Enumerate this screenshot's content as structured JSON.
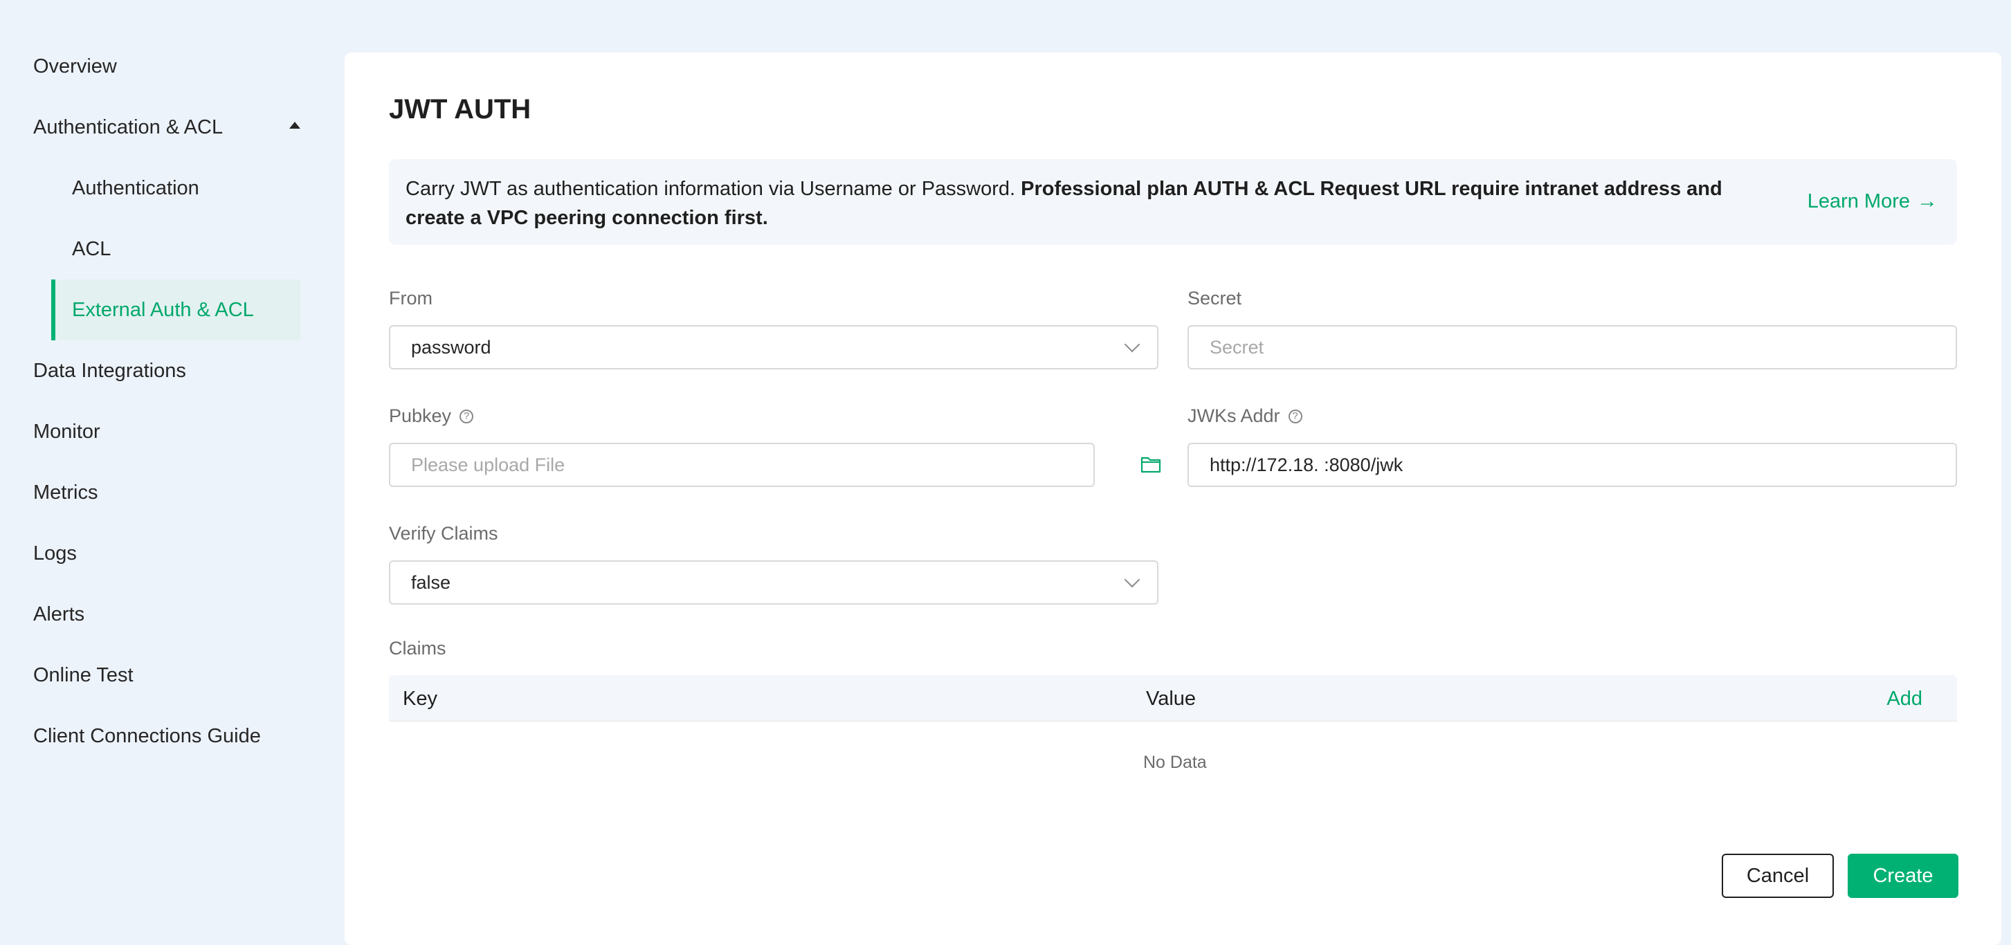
{
  "sidebar": {
    "items": [
      {
        "label": "Overview"
      },
      {
        "label": "Authentication & ACL"
      },
      {
        "label": "Authentication"
      },
      {
        "label": "ACL"
      },
      {
        "label": "External Auth & ACL"
      },
      {
        "label": "Data Integrations"
      },
      {
        "label": "Monitor"
      },
      {
        "label": "Metrics"
      },
      {
        "label": "Logs"
      },
      {
        "label": "Alerts"
      },
      {
        "label": "Online Test"
      },
      {
        "label": "Client Connections Guide"
      }
    ],
    "active": "External Auth & ACL"
  },
  "page": {
    "title": "JWT AUTH"
  },
  "banner": {
    "text_plain": "Carry JWT as authentication information via Username or Password. ",
    "text_bold": "Professional plan AUTH & ACL Request URL require intranet address and create a VPC peering connection first.",
    "learn_more": "Learn More",
    "arrow": "→"
  },
  "form": {
    "from": {
      "label": "From",
      "value": "password"
    },
    "secret": {
      "label": "Secret",
      "placeholder": "Secret"
    },
    "pubkey": {
      "label": "Pubkey",
      "placeholder": "Please upload File"
    },
    "jwks_addr": {
      "label": "JWKs Addr",
      "value": "http://172.18.   :8080/jwk"
    },
    "verify_claims": {
      "label": "Verify Claims",
      "value": "false"
    },
    "help_glyph": "?"
  },
  "claims": {
    "label": "Claims",
    "columns": [
      "Key",
      "Value"
    ],
    "add_label": "Add",
    "empty_text": "No Data"
  },
  "actions": {
    "cancel": "Cancel",
    "create": "Create"
  },
  "colors": {
    "accent": "#00b173",
    "accent_text": "#00a86b",
    "background": "#edf3fb"
  }
}
